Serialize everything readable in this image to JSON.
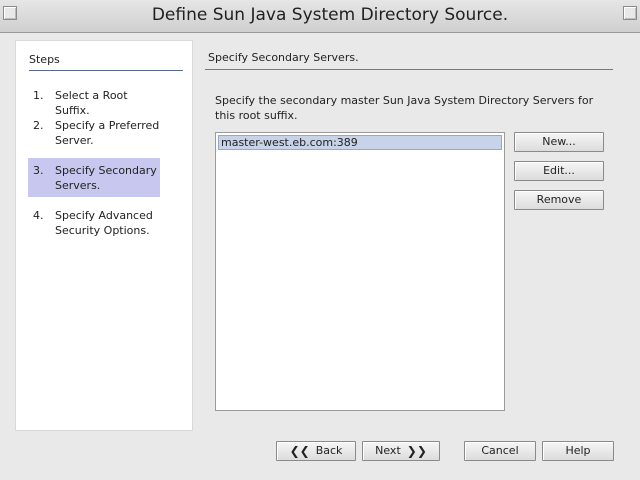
{
  "window": {
    "title": "Define Sun Java System Directory Source."
  },
  "steps": {
    "header": "Steps",
    "items": [
      {
        "num": "1.",
        "label": "Select a Root Suffix."
      },
      {
        "num": "2.",
        "label": "Specify a Preferred Server."
      },
      {
        "num": "3.",
        "label": "Specify Secondary Servers.",
        "active": true
      },
      {
        "num": "4.",
        "label": "Specify Advanced Security Options."
      }
    ]
  },
  "content": {
    "section_title": "Specify Secondary Servers.",
    "description": "Specify the secondary master Sun Java System Directory Servers for this root suffix.",
    "servers": [
      "master-west.eb.com:389"
    ],
    "new_label": "New...",
    "edit_label": "Edit...",
    "remove_label": "Remove"
  },
  "footer": {
    "back_label": "Back",
    "next_label": "Next",
    "cancel_label": "Cancel",
    "help_label": "Help"
  },
  "icons": {
    "back_arrow": "double-left-arrow-icon",
    "next_arrow": "double-right-arrow-icon"
  },
  "colors": {
    "active_step_bg": "#c7c7ef",
    "selected_row_bg": "#c7d3e8",
    "rule_color": "#6b7a9a"
  }
}
